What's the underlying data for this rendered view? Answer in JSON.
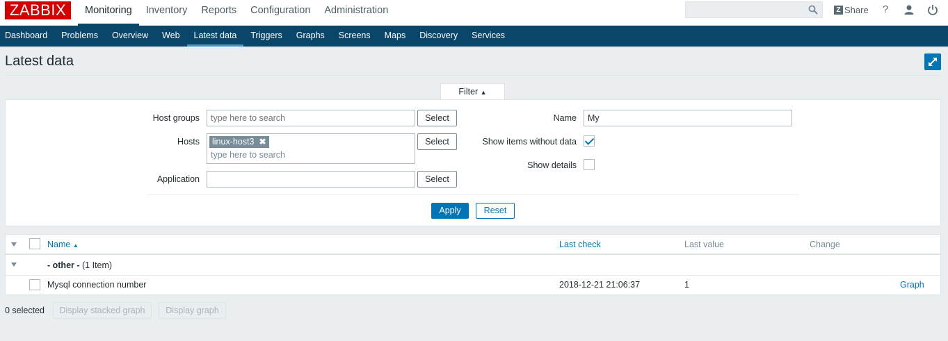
{
  "header": {
    "logo": "ZABBIX",
    "menu": [
      "Monitoring",
      "Inventory",
      "Reports",
      "Configuration",
      "Administration"
    ],
    "active_menu": "Monitoring",
    "search": {
      "value": "",
      "placeholder": ""
    },
    "share_label": "Share",
    "help_glyph": "?"
  },
  "subnav": {
    "items": [
      "Dashboard",
      "Problems",
      "Overview",
      "Web",
      "Latest data",
      "Triggers",
      "Graphs",
      "Screens",
      "Maps",
      "Discovery",
      "Services"
    ],
    "active": "Latest data"
  },
  "page": {
    "title": "Latest data"
  },
  "filter": {
    "tab_label": "Filter",
    "host_groups": {
      "label": "Host groups",
      "placeholder": "type here to search",
      "select_label": "Select"
    },
    "hosts": {
      "label": "Hosts",
      "tag": "linux-host3",
      "placeholder": "type here to search",
      "select_label": "Select"
    },
    "application": {
      "label": "Application",
      "value": "",
      "select_label": "Select"
    },
    "name": {
      "label": "Name",
      "value": "My"
    },
    "show_items_without_data": {
      "label": "Show items without data",
      "checked": true
    },
    "show_details": {
      "label": "Show details",
      "checked": false
    },
    "apply_label": "Apply",
    "reset_label": "Reset"
  },
  "table": {
    "headers": {
      "name": "Name",
      "last_check": "Last check",
      "last_value": "Last value",
      "change": "Change"
    },
    "group": {
      "name": "- other -",
      "count": "(1 Item)"
    },
    "rows": [
      {
        "name": "Mysql connection number",
        "last_check": "2018-12-21 21:06:37",
        "last_value": "1",
        "change": "",
        "action": "Graph"
      }
    ]
  },
  "footer": {
    "selected": "0 selected",
    "stacked_label": "Display stacked graph",
    "graph_label": "Display graph"
  },
  "colors": {
    "brand": "#d40000",
    "nav": "#0a466a",
    "accent": "#0275b8"
  }
}
